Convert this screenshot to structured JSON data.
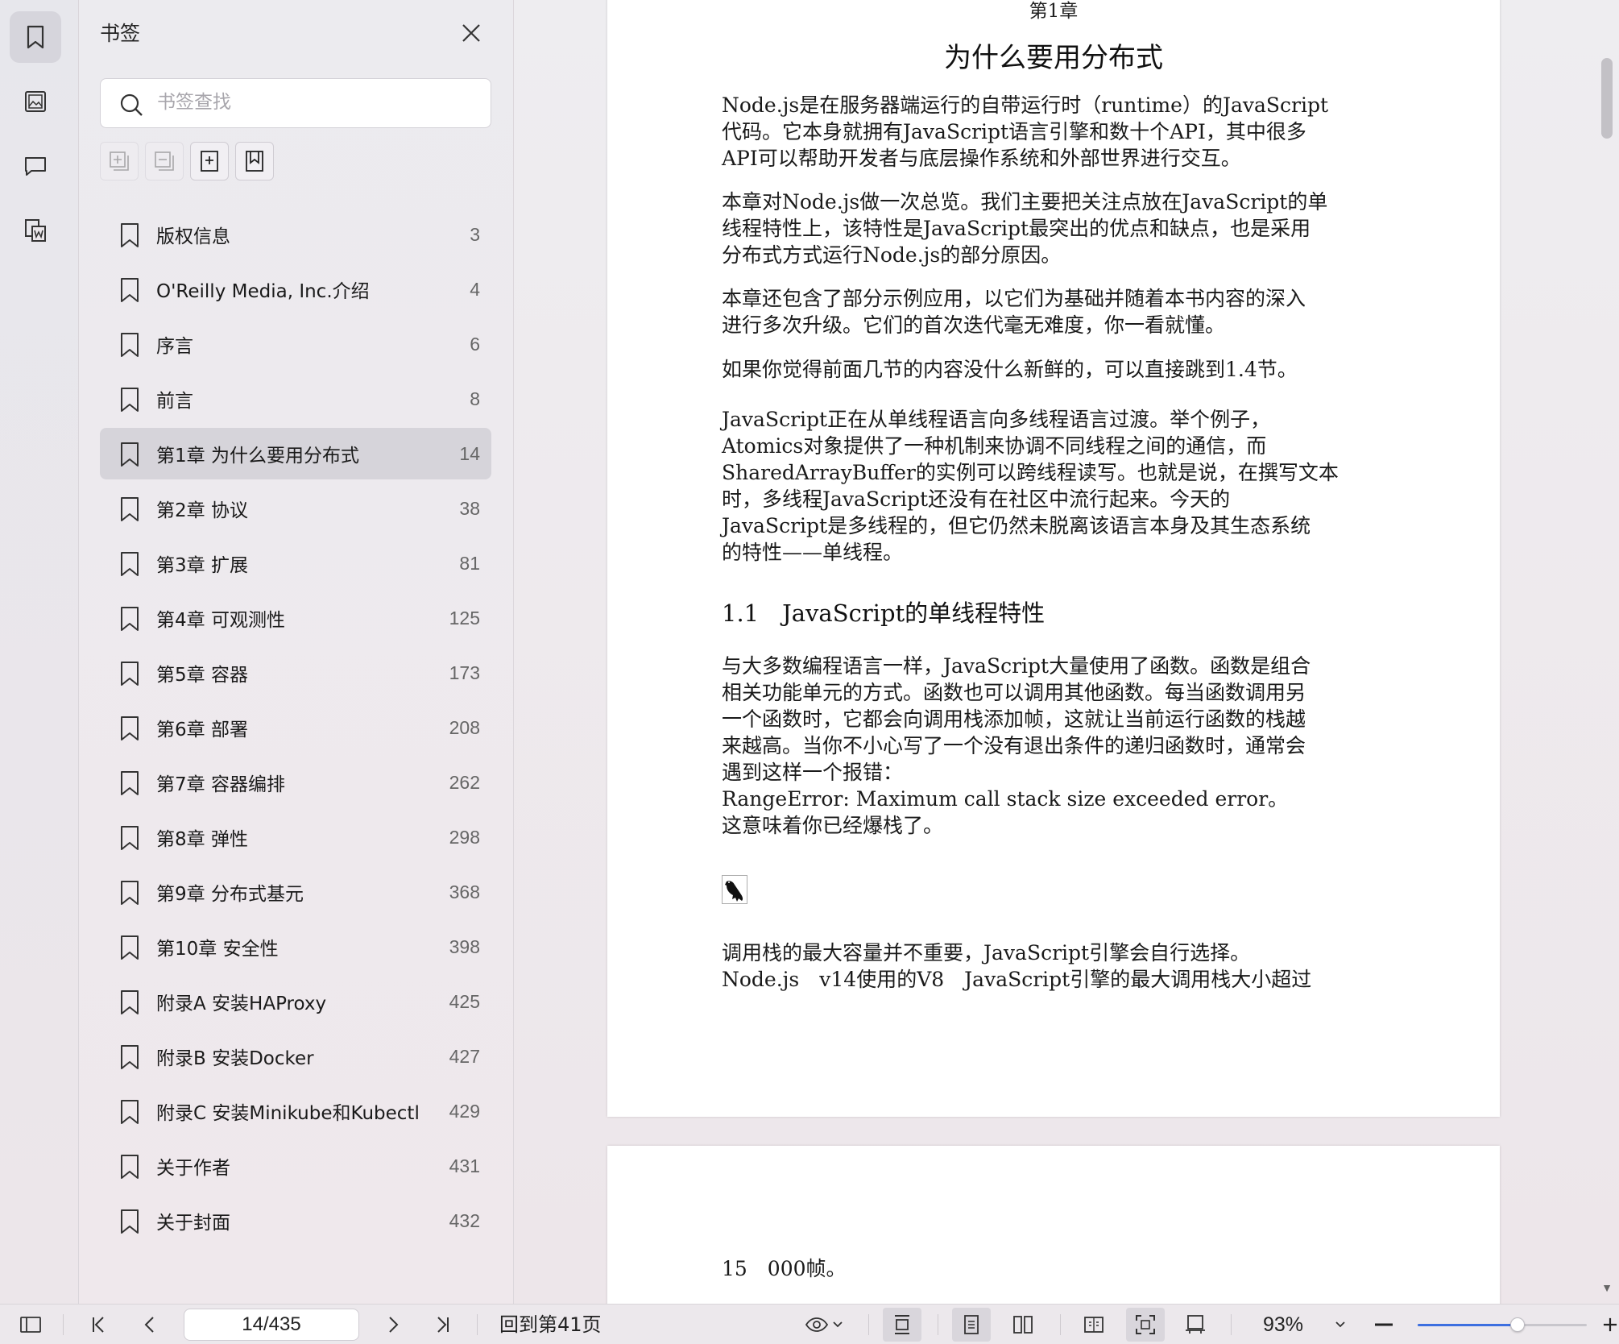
{
  "rail": {
    "items": [
      {
        "name": "bookmark-panel"
      },
      {
        "name": "thumbnail-panel"
      },
      {
        "name": "comment-panel"
      },
      {
        "name": "extract-panel"
      }
    ]
  },
  "panel": {
    "title": "书签",
    "search_placeholder": "书签查找"
  },
  "bookmarks": [
    {
      "label": "版权信息",
      "page": "3"
    },
    {
      "label": "O'Reilly Media, Inc.介绍",
      "page": "4"
    },
    {
      "label": "序言",
      "page": "6"
    },
    {
      "label": "前言",
      "page": "8"
    },
    {
      "label": "第1章 为什么要用分布式",
      "page": "14"
    },
    {
      "label": "第2章 协议",
      "page": "38"
    },
    {
      "label": "第3章 扩展",
      "page": "81"
    },
    {
      "label": "第4章 可观测性",
      "page": "125"
    },
    {
      "label": "第5章 容器",
      "page": "173"
    },
    {
      "label": "第6章 部署",
      "page": "208"
    },
    {
      "label": "第7章 容器编排",
      "page": "262"
    },
    {
      "label": "第8章 弹性",
      "page": "298"
    },
    {
      "label": "第9章 分布式基元",
      "page": "368"
    },
    {
      "label": "第10章 安全性",
      "page": "398"
    },
    {
      "label": "附录A 安装HAProxy",
      "page": "425"
    },
    {
      "label": "附录B 安装Docker",
      "page": "427"
    },
    {
      "label": "附录C 安装Minikube和Kubectl",
      "page": "429"
    },
    {
      "label": "关于作者",
      "page": "431"
    },
    {
      "label": "关于封面",
      "page": "432"
    }
  ],
  "selected_bookmark": 4,
  "document": {
    "chapter_label": "第1章",
    "chapter_title": "为什么要用分布式",
    "paragraphs": [
      [
        "Node.js是在服务器端运行的自带运行时（runtime）的JavaScript",
        "代码。它本身就拥有JavaScript语言引擎和数十个API，其中很多",
        "API可以帮助开发者与底层操作系统和外部世界进行交互。"
      ],
      [
        "本章对Node.js做一次总览。我们主要把关注点放在JavaScript的单",
        "线程特性上，该特性是JavaScript最突出的优点和缺点，也是采用",
        "分布式方式运行Node.js的部分原因。"
      ],
      [
        "本章还包含了部分示例应用，以它们为基础并随着本书内容的深入",
        "进行多次升级。它们的首次迭代毫无难度，你一看就懂。"
      ],
      [
        "如果你觉得前面几节的内容没什么新鲜的，可以直接跳到1.4节。"
      ],
      [
        "JavaScript正在从单线程语言向多线程语言过渡。举个例子，",
        "Atomics对象提供了一种机制来协调不同线程之间的通信，而",
        "SharedArrayBuffer的实例可以跨线程读写。也就是说，在撰写文本",
        "时，多线程JavaScript还没有在社区中流行起来。今天的",
        "JavaScript是多线程的，但它仍然未脱离该语言本身及其生态系统",
        "的特性——单线程。"
      ]
    ],
    "section_title": "1.1　JavaScript的单线程特性",
    "section_paragraph": [
      "与大多数编程语言一样，JavaScript大量使用了函数。函数是组合",
      "相关功能单元的方式。函数也可以调用其他函数。每当函数调用另",
      "一个函数时，它都会向调用栈添加帧，这就让当前运行函数的栈越",
      "来越高。当你不小心写了一个没有退出条件的递归函数时，通常会",
      "遇到这样一个报错："
    ],
    "error_line": "RangeError:  Maximum  call  stack  size  exceeded  error。",
    "error_after": "这意味着你已经爆栈了。",
    "note_lines": [
      "调用栈的最大容量并不重要，JavaScript引擎会自行选择。",
      "Node.js　v14使用的V8　JavaScript引擎的最大调用栈大小超过"
    ],
    "page2_text": "15　000帧。"
  },
  "toolbar": {
    "page_value": "14/435",
    "back_to": "回到第41页",
    "zoom": "93%",
    "zoom_fraction": 0.59
  }
}
